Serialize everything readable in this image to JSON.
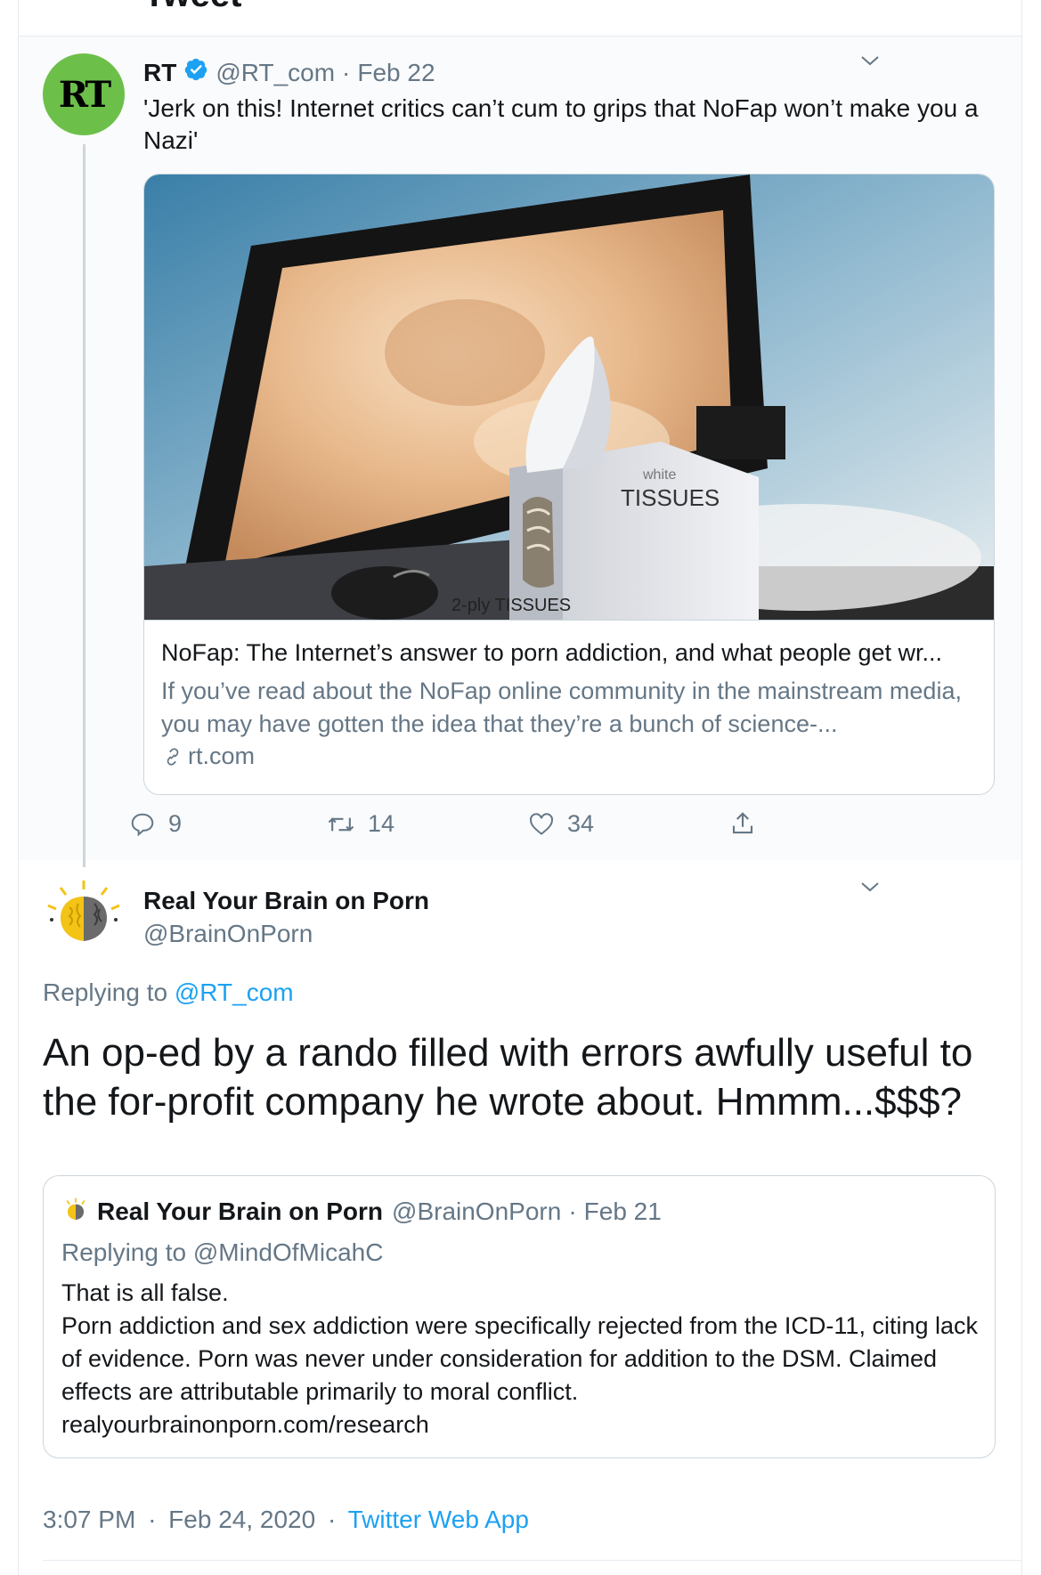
{
  "header": {
    "title": "Tweet"
  },
  "parent_tweet": {
    "avatar_text": "RT",
    "name": "RT",
    "handle": "@RT_com",
    "date": "Feb 22",
    "separator": "·",
    "text": "'Jerk on this! Internet critics can’t cum to grips that NoFap won’t make you a Nazi'",
    "card": {
      "image_text_box": "white",
      "image_text_brand": "TISSUES",
      "image_text_side": "2-ply TISSUES",
      "title": "NoFap: The Internet’s answer to porn addiction, and what people get wr...",
      "description": "If you’ve read about the NoFap online community in the mainstream media, you may have gotten the idea that they’re a bunch of science-...",
      "domain": "rt.com"
    },
    "actions": {
      "replies": "9",
      "retweets": "14",
      "likes": "34"
    }
  },
  "main_tweet": {
    "name": "Real Your Brain on Porn",
    "handle": "@BrainOnPorn",
    "replying_label": "Replying to",
    "replying_handle": "@RT_com",
    "text": "An op-ed by a rando filled with errors awfully useful to the for-profit company he wrote about. Hmmm...$$$?",
    "quote": {
      "name": "Real Your Brain on Porn",
      "handle": "@BrainOnPorn",
      "date": "Feb 21",
      "separator": "·",
      "replying": "Replying to @MindOfMicahC",
      "text": "That is all false.\nPorn addiction and sex addiction were specifically rejected from the ICD-11, citing lack of evidence. Porn was never under consideration for addition to the DSM. Claimed effects are attributable primarily to moral conflict.\nrealyourbrainonporn.com/research"
    },
    "time": "3:07 PM",
    "date": "Feb 24, 2020",
    "separator": "·",
    "source": "Twitter Web App"
  },
  "colors": {
    "accent": "#1da1f2",
    "secondary_text": "#657786",
    "border": "#ccd6dd",
    "rt_green": "#6cc04a"
  }
}
